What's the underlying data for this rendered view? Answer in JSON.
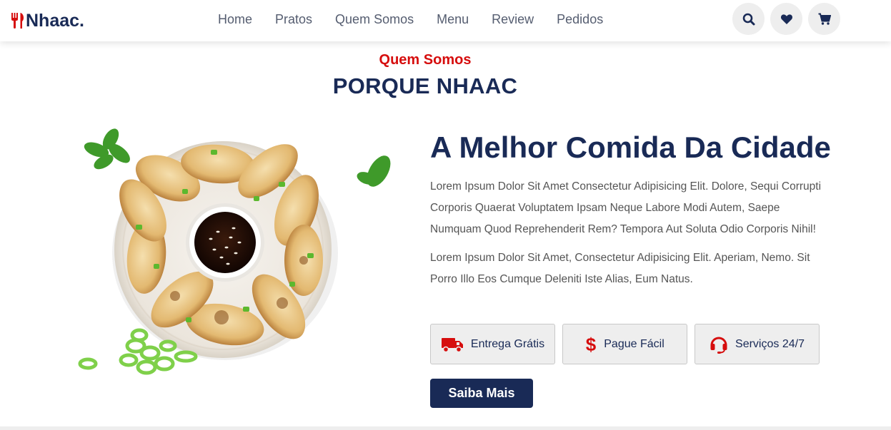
{
  "header": {
    "logo_text": "Nhaac.",
    "nav": [
      "Home",
      "Pratos",
      "Quem Somos",
      "Menu",
      "Review",
      "Pedidos"
    ],
    "icons": [
      "search-icon",
      "heart-icon",
      "cart-icon"
    ]
  },
  "section": {
    "subheading": "Quem Somos",
    "heading": "PORQUE NHAAC",
    "content_title": "A Melhor Comida Da Cidade",
    "paragraph1": "Lorem Ipsum Dolor Sit Amet Consectetur Adipisicing Elit. Dolore, Sequi Corrupti Corporis Quaerat Voluptatem Ipsam Neque Labore Modi Autem, Saepe Numquam Quod Reprehenderit Rem? Tempora Aut Soluta Odio Corporis Nihil!",
    "paragraph2": "Lorem Ipsum Dolor Sit Amet, Consectetur Adipisicing Elit. Aperiam, Nemo. Sit Porro Illo Eos Cumque Deleniti Iste Alias, Eum Natus.",
    "features": [
      {
        "label": "Entrega Grátis",
        "icon": "truck-icon"
      },
      {
        "label": "Pague Fácil",
        "icon": "dollar-icon"
      },
      {
        "label": "Serviços 24/7",
        "icon": "headset-icon"
      }
    ],
    "button_label": "Saiba Mais"
  },
  "colors": {
    "accent": "#d60d0d",
    "brand": "#192a56",
    "text": "#555555",
    "feature_bg": "#eeeeee"
  }
}
